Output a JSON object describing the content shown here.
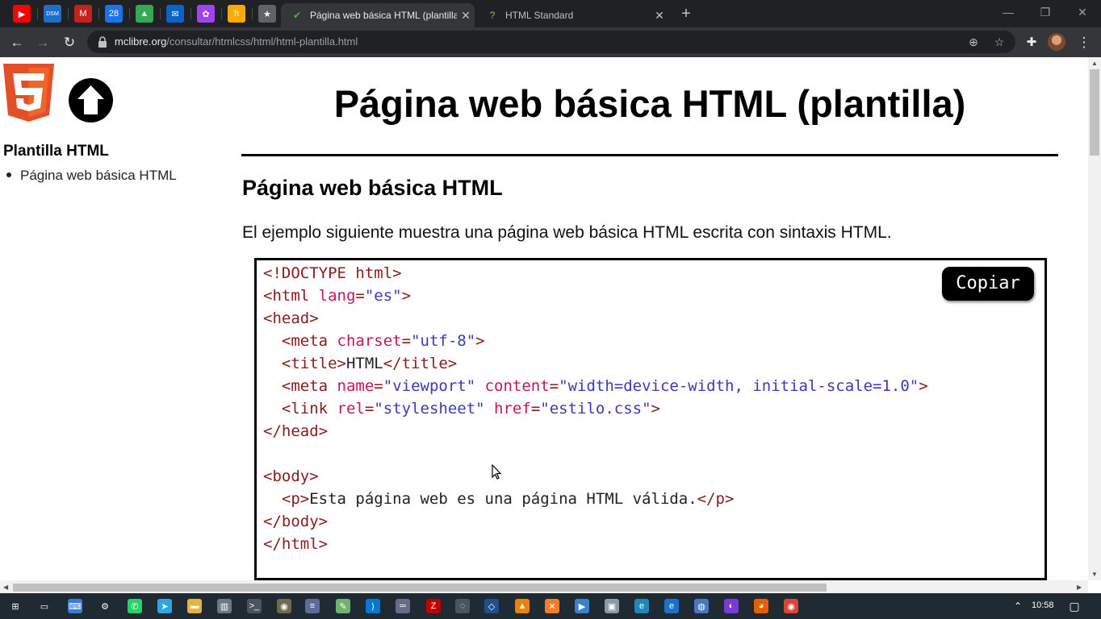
{
  "browser": {
    "pinned_tabs": [
      {
        "name": "youtube",
        "glyph": "▶",
        "color": "#ff0000"
      },
      {
        "name": "dsm",
        "glyph": "DSM",
        "color": "#1f6fc5"
      },
      {
        "name": "gmail",
        "glyph": "M",
        "color": "#c5221f"
      },
      {
        "name": "calendar",
        "glyph": "28",
        "color": "#1a73e8"
      },
      {
        "name": "drive",
        "glyph": "▲",
        "color": "#34a853"
      },
      {
        "name": "mail",
        "glyph": "✉",
        "color": "#0a64c8"
      },
      {
        "name": "photos",
        "glyph": "✿",
        "color": "#a142f4"
      },
      {
        "name": "keep",
        "glyph": "h",
        "color": "#f9ab00"
      },
      {
        "name": "bookmarks",
        "glyph": "★",
        "color": "#5f6368"
      }
    ],
    "tabs": [
      {
        "title": "Página web básica HTML (plantilla)",
        "favicon": "✔",
        "favicon_color": "#49b04c",
        "active": true
      },
      {
        "title": "HTML Standard",
        "favicon": "?",
        "favicon_color": "#8bc34a",
        "active": false
      }
    ],
    "url": {
      "host": "mclibre.org",
      "path": "/consultar/htmlcss/html/html-plantilla.html"
    }
  },
  "page": {
    "sidebar": {
      "title": "Plantilla HTML",
      "items": [
        "Página web básica HTML"
      ]
    },
    "main_title": "Página web básica HTML (plantilla)",
    "section_heading": "Página web básica HTML",
    "intro": "El ejemplo siguiente muestra una página web básica HTML escrita con sintaxis HTML.",
    "copy_button": "Copiar",
    "code_lines": [
      [
        {
          "t": "tg",
          "v": "<!DOCTYPE html>"
        }
      ],
      [
        {
          "t": "tg",
          "v": "<html "
        },
        {
          "t": "at",
          "v": "lang"
        },
        {
          "t": "tg",
          "v": "="
        },
        {
          "t": "st",
          "v": "\"es\""
        },
        {
          "t": "tg",
          "v": ">"
        }
      ],
      [
        {
          "t": "tg",
          "v": "<head>"
        }
      ],
      [
        {
          "t": "tx",
          "v": "  "
        },
        {
          "t": "tg",
          "v": "<meta "
        },
        {
          "t": "at",
          "v": "charset"
        },
        {
          "t": "tg",
          "v": "="
        },
        {
          "t": "st",
          "v": "\"utf-8\""
        },
        {
          "t": "tg",
          "v": ">"
        }
      ],
      [
        {
          "t": "tx",
          "v": "  "
        },
        {
          "t": "tg",
          "v": "<title>"
        },
        {
          "t": "tx",
          "v": "HTML"
        },
        {
          "t": "tg",
          "v": "</title>"
        }
      ],
      [
        {
          "t": "tx",
          "v": "  "
        },
        {
          "t": "tg",
          "v": "<meta "
        },
        {
          "t": "at",
          "v": "name"
        },
        {
          "t": "tg",
          "v": "="
        },
        {
          "t": "st",
          "v": "\"viewport\""
        },
        {
          "t": "tx",
          "v": " "
        },
        {
          "t": "at",
          "v": "content"
        },
        {
          "t": "tg",
          "v": "="
        },
        {
          "t": "st",
          "v": "\"width=device-width, initial-scale=1.0\""
        },
        {
          "t": "tg",
          "v": ">"
        }
      ],
      [
        {
          "t": "tx",
          "v": "  "
        },
        {
          "t": "tg",
          "v": "<link "
        },
        {
          "t": "at",
          "v": "rel"
        },
        {
          "t": "tg",
          "v": "="
        },
        {
          "t": "st",
          "v": "\"stylesheet\""
        },
        {
          "t": "tx",
          "v": " "
        },
        {
          "t": "at",
          "v": "href"
        },
        {
          "t": "tg",
          "v": "="
        },
        {
          "t": "st",
          "v": "\"estilo.css\""
        },
        {
          "t": "tg",
          "v": ">"
        }
      ],
      [
        {
          "t": "tg",
          "v": "</head>"
        }
      ],
      [],
      [
        {
          "t": "tg",
          "v": "<body>"
        }
      ],
      [
        {
          "t": "tx",
          "v": "  "
        },
        {
          "t": "tg",
          "v": "<p>"
        },
        {
          "t": "tx",
          "v": "Esta página web es una página HTML válida."
        },
        {
          "t": "tg",
          "v": "</p>"
        }
      ],
      [
        {
          "t": "tg",
          "v": "</body>"
        }
      ],
      [
        {
          "t": "tg",
          "v": "</html>"
        }
      ]
    ]
  },
  "taskbar": {
    "time": "10:58",
    "apps": [
      {
        "name": "start",
        "glyph": "⊞",
        "color": "#1f2a33"
      },
      {
        "name": "task-view",
        "glyph": "▭",
        "color": "#1f2a33"
      },
      {
        "name": "keyboard",
        "glyph": "⌨",
        "color": "#3a7bd5"
      },
      {
        "name": "settings",
        "glyph": "⚙",
        "color": "#1f2a33"
      },
      {
        "name": "whatsapp",
        "glyph": "✆",
        "color": "#25d366"
      },
      {
        "name": "telegram",
        "glyph": "➤",
        "color": "#2ca5e0"
      },
      {
        "name": "explorer",
        "glyph": "▬",
        "color": "#e8b33a"
      },
      {
        "name": "app-library",
        "glyph": "▥",
        "color": "#6b7a86"
      },
      {
        "name": "terminal",
        "glyph": ">_",
        "color": "#4a5560"
      },
      {
        "name": "gimp",
        "glyph": "◉",
        "color": "#6d6d4b"
      },
      {
        "name": "document",
        "glyph": "≡",
        "color": "#5b6b9a"
      },
      {
        "name": "notepad",
        "glyph": "✎",
        "color": "#6fb36f"
      },
      {
        "name": "vscode",
        "glyph": "⟩",
        "color": "#0078d7"
      },
      {
        "name": "drive-app",
        "glyph": "═",
        "color": "#6a6a8a"
      },
      {
        "name": "filezilla",
        "glyph": "Z",
        "color": "#bf0000"
      },
      {
        "name": "chromium",
        "glyph": "◌",
        "color": "#4a5560"
      },
      {
        "name": "virtualbox",
        "glyph": "◇",
        "color": "#1f4f8c"
      },
      {
        "name": "vlc",
        "glyph": "▲",
        "color": "#f08000"
      },
      {
        "name": "xampp",
        "glyph": "✕",
        "color": "#fb7a24"
      },
      {
        "name": "media-player",
        "glyph": "▶",
        "color": "#3a80d0"
      },
      {
        "name": "remote-desktop",
        "glyph": "▣",
        "color": "#8a9aa8"
      },
      {
        "name": "edge",
        "glyph": "e",
        "color": "#1e88b8"
      },
      {
        "name": "internet-explorer",
        "glyph": "e",
        "color": "#1a73c8"
      },
      {
        "name": "chrome-canary",
        "glyph": "◍",
        "color": "#4a78c0"
      },
      {
        "name": "firefox-dev",
        "glyph": "◐",
        "color": "#7a3ad8"
      },
      {
        "name": "firefox",
        "glyph": "◕",
        "color": "#e66000"
      },
      {
        "name": "chrome",
        "glyph": "◉",
        "color": "#db4437"
      }
    ]
  }
}
